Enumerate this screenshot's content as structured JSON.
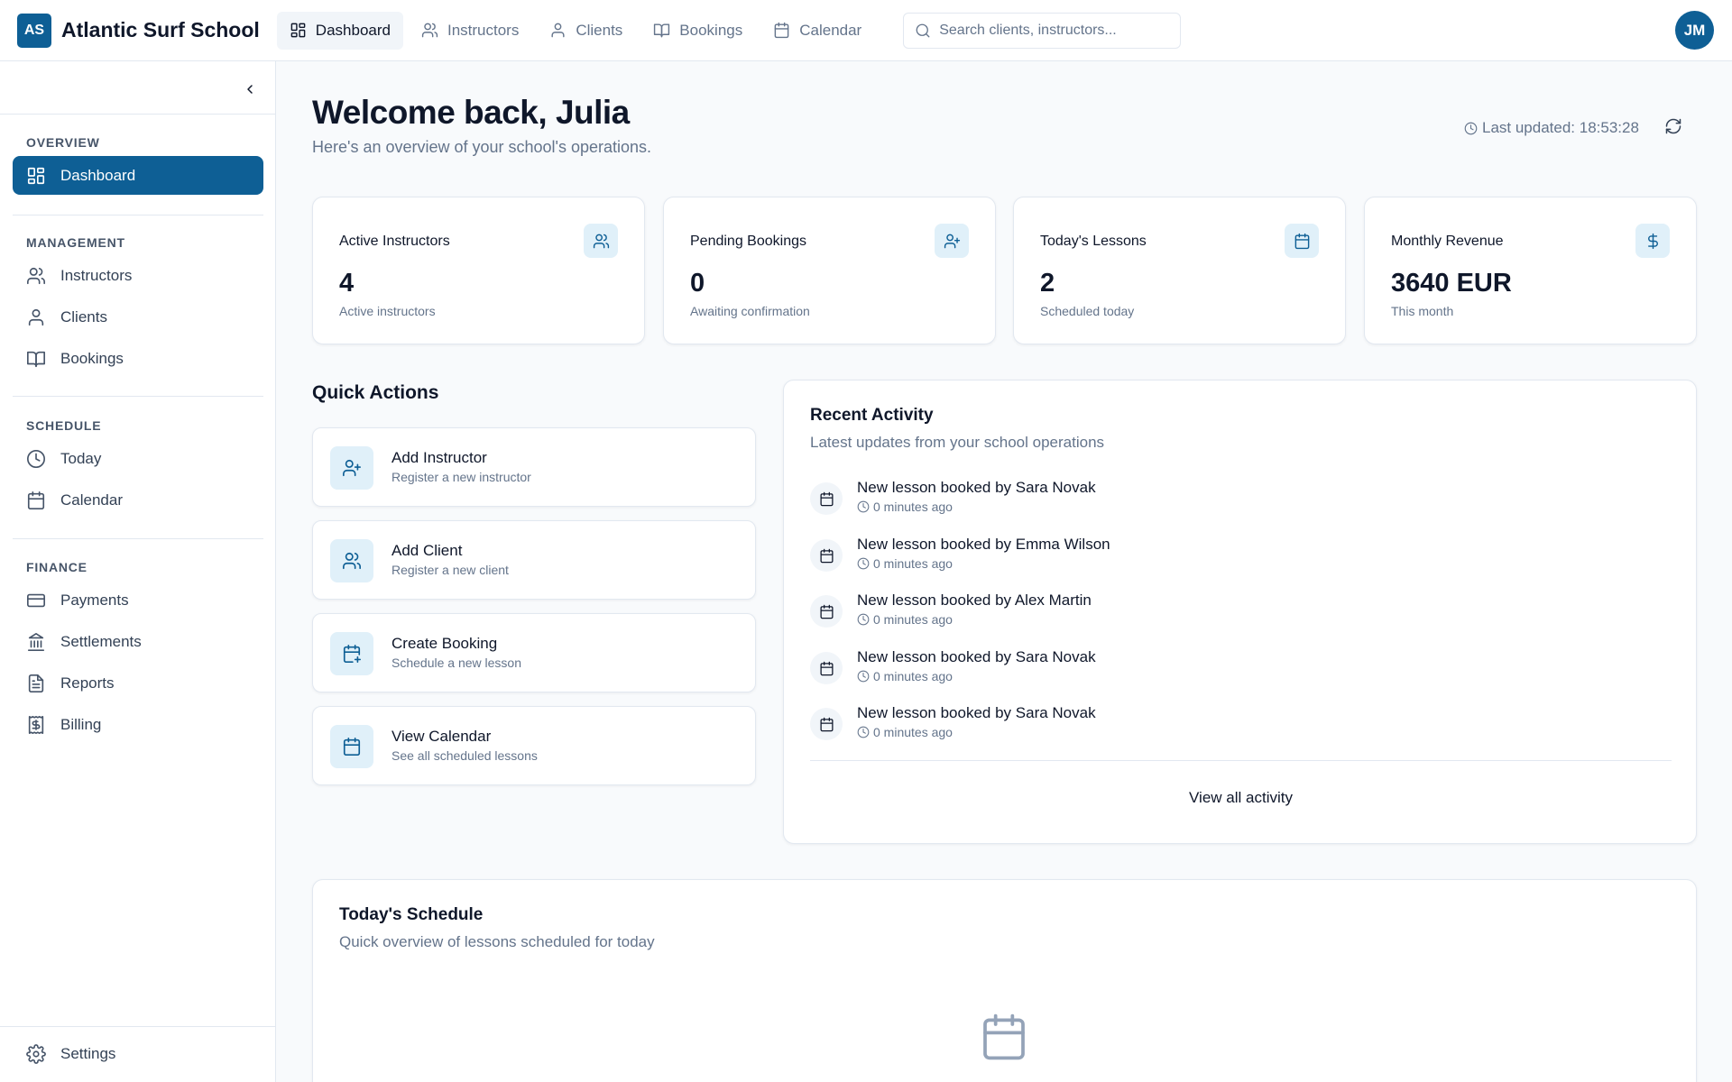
{
  "app": {
    "logo_initials": "AS",
    "name": "Atlantic Surf School",
    "accent_color": "#0e5f95"
  },
  "topnav": {
    "items": [
      {
        "label": "Dashboard",
        "icon": "dashboard-icon",
        "active": true
      },
      {
        "label": "Instructors",
        "icon": "users-icon"
      },
      {
        "label": "Clients",
        "icon": "user-icon"
      },
      {
        "label": "Bookings",
        "icon": "book-icon"
      },
      {
        "label": "Calendar",
        "icon": "calendar-icon"
      }
    ],
    "search_placeholder": "Search clients, instructors...",
    "user_initials": "JM"
  },
  "sidebar": {
    "sections": [
      {
        "title": "OVERVIEW",
        "items": [
          {
            "label": "Dashboard",
            "icon": "dashboard-icon",
            "active": true
          }
        ]
      },
      {
        "title": "MANAGEMENT",
        "items": [
          {
            "label": "Instructors",
            "icon": "users-icon"
          },
          {
            "label": "Clients",
            "icon": "user-icon"
          },
          {
            "label": "Bookings",
            "icon": "book-icon"
          }
        ]
      },
      {
        "title": "SCHEDULE",
        "items": [
          {
            "label": "Today",
            "icon": "clock-icon"
          },
          {
            "label": "Calendar",
            "icon": "calendar-icon"
          }
        ]
      },
      {
        "title": "FINANCE",
        "items": [
          {
            "label": "Payments",
            "icon": "credit-card-icon"
          },
          {
            "label": "Settlements",
            "icon": "bank-icon"
          },
          {
            "label": "Reports",
            "icon": "file-text-icon"
          },
          {
            "label": "Billing",
            "icon": "receipt-icon"
          }
        ]
      }
    ],
    "settings_label": "Settings"
  },
  "header": {
    "title": "Welcome back, Julia",
    "subtitle": "Here's an overview of your school's operations.",
    "last_updated": "Last updated: 18:53:28"
  },
  "stats": [
    {
      "title": "Active Instructors",
      "value": "4",
      "sub": "Active instructors",
      "icon": "users-icon"
    },
    {
      "title": "Pending Bookings",
      "value": "0",
      "sub": "Awaiting confirmation",
      "icon": "user-plus-icon"
    },
    {
      "title": "Today's Lessons",
      "value": "2",
      "sub": "Scheduled today",
      "icon": "calendar-icon"
    },
    {
      "title": "Monthly Revenue",
      "value": "3640 EUR",
      "sub": "This month",
      "icon": "dollar-icon"
    }
  ],
  "quick_actions": {
    "title": "Quick Actions",
    "items": [
      {
        "label": "Add Instructor",
        "desc": "Register a new instructor",
        "icon": "user-plus-icon"
      },
      {
        "label": "Add Client",
        "desc": "Register a new client",
        "icon": "users-icon"
      },
      {
        "label": "Create Booking",
        "desc": "Schedule a new lesson",
        "icon": "calendar-plus-icon"
      },
      {
        "label": "View Calendar",
        "desc": "See all scheduled lessons",
        "icon": "calendar-icon"
      }
    ]
  },
  "activity": {
    "title": "Recent Activity",
    "subtitle": "Latest updates from your school operations",
    "items": [
      {
        "text": "New lesson booked by Sara Novak",
        "time": "0 minutes ago"
      },
      {
        "text": "New lesson booked by Emma Wilson",
        "time": "0 minutes ago"
      },
      {
        "text": "New lesson booked by Alex Martin",
        "time": "0 minutes ago"
      },
      {
        "text": "New lesson booked by Sara Novak",
        "time": "0 minutes ago"
      },
      {
        "text": "New lesson booked by Sara Novak",
        "time": "0 minutes ago"
      }
    ],
    "view_all": "View all activity"
  },
  "schedule": {
    "title": "Today's Schedule",
    "subtitle": "Quick overview of lessons scheduled for today"
  }
}
